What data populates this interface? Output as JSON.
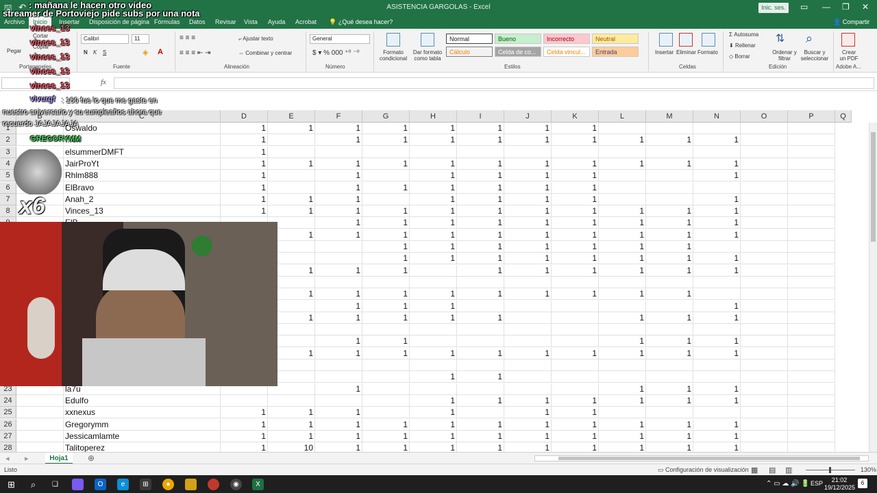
{
  "window": {
    "title": "ASISTENCIA GARGOLAS  -  Excel",
    "signin": "Inic. ses."
  },
  "tabs": [
    "Archivo",
    "Inicio",
    "Insertar",
    "Disposición de página",
    "Fórmulas",
    "Datos",
    "Revisar",
    "Vista",
    "Ayuda",
    "Acrobat"
  ],
  "tell_me": "¿Qué desea hacer?",
  "share": "Compartir",
  "ribbon": {
    "clipboard": {
      "cut": "Cortar",
      "copy": "Copiar",
      "paste": "Pegar",
      "label": "Portapapeles"
    },
    "font": {
      "name": "Calibri",
      "size": "11",
      "label": "Fuente",
      "bold": "N",
      "italic": "K",
      "underline": "S"
    },
    "alignment": {
      "wrap": "Ajustar texto",
      "merge": "Combinar y centrar",
      "label": "Alineación"
    },
    "number": {
      "format": "General",
      "label": "Número"
    },
    "styles": {
      "cond": "Formato condicional",
      "table": "Dar formato como tabla",
      "label": "Estilos",
      "normal": "Normal",
      "bueno": "Bueno",
      "incorrecto": "Incorrecto",
      "neutral": "Neutral",
      "calculo": "Cálculo",
      "celda_co": "Celda de co...",
      "celda_vinc": "Celda vincul...",
      "entrada": "Entrada"
    },
    "cells": {
      "insert": "Insertar",
      "delete": "Eliminar",
      "format": "Formato",
      "label": "Celdas"
    },
    "editing": {
      "autosum": "Autosuma",
      "fill": "Rellenar",
      "clear": "Borrar",
      "sort": "Ordenar y filtrar",
      "find": "Buscar y seleccionar",
      "label": "Edición"
    },
    "adobe": {
      "create": "Crear un PDF",
      "label": "Adobe A..."
    }
  },
  "formula": {
    "fx": "fx"
  },
  "columns": [
    "B",
    "C",
    "D",
    "E",
    "F",
    "G",
    "H",
    "I",
    "J",
    "K",
    "L",
    "M",
    "N",
    "O",
    "P",
    "Q"
  ],
  "rows": [
    {
      "n": "1",
      "name": "Oswaldo",
      "v": [
        "1",
        "1",
        "1",
        "1",
        "1",
        "1",
        "1",
        "1",
        "",
        "",
        ""
      ]
    },
    {
      "n": "2",
      "name": "...ex",
      "v": [
        "1",
        "",
        "1",
        "1",
        "1",
        "1",
        "1",
        "1",
        "1",
        "1",
        "1"
      ]
    },
    {
      "n": "3",
      "name": "elsummerDMFT",
      "v": [
        "1",
        "",
        "",
        "",
        "",
        "",
        "",
        "",
        "",
        "",
        ""
      ]
    },
    {
      "n": "4",
      "name": "JairProYt",
      "v": [
        "1",
        "1",
        "1",
        "1",
        "1",
        "1",
        "1",
        "1",
        "1",
        "1",
        "1"
      ]
    },
    {
      "n": "5",
      "name": "Rhlm888",
      "v": [
        "1",
        "",
        "1",
        "",
        "1",
        "1",
        "1",
        "1",
        "",
        "",
        "1"
      ]
    },
    {
      "n": "6",
      "name": "ElBravo",
      "v": [
        "1",
        "",
        "1",
        "1",
        "1",
        "1",
        "1",
        "1",
        "",
        "",
        ""
      ]
    },
    {
      "n": "7",
      "name": "Anah_2",
      "v": [
        "1",
        "1",
        "1",
        "",
        "1",
        "1",
        "1",
        "1",
        "",
        "",
        "1"
      ]
    },
    {
      "n": "8",
      "name": "Vinces_13",
      "v": [
        "1",
        "1",
        "1",
        "1",
        "1",
        "1",
        "1",
        "1",
        "1",
        "1",
        "1"
      ]
    },
    {
      "n": "9",
      "name": "ElB...",
      "v": [
        "",
        "",
        "1",
        "1",
        "1",
        "1",
        "1",
        "1",
        "1",
        "1",
        "1"
      ]
    },
    {
      "n": "10",
      "name": "",
      "v": [
        "",
        "1",
        "1",
        "1",
        "1",
        "1",
        "1",
        "1",
        "1",
        "1",
        "1"
      ]
    },
    {
      "n": "11",
      "name": "",
      "v": [
        "",
        "",
        "",
        "1",
        "1",
        "1",
        "1",
        "1",
        "1",
        "1",
        ""
      ]
    },
    {
      "n": "12",
      "name": "",
      "v": [
        "",
        "",
        "",
        "1",
        "1",
        "1",
        "1",
        "1",
        "1",
        "1",
        "1"
      ]
    },
    {
      "n": "13",
      "name": "",
      "v": [
        "",
        "1",
        "1",
        "1",
        "",
        "1",
        "1",
        "1",
        "1",
        "1",
        "1"
      ]
    },
    {
      "n": "14",
      "name": "",
      "v": [
        "",
        "",
        "",
        "",
        "",
        "",
        "",
        "",
        "",
        "",
        ""
      ]
    },
    {
      "n": "15",
      "name": "",
      "v": [
        "",
        "1",
        "1",
        "1",
        "1",
        "1",
        "1",
        "1",
        "1",
        "1",
        ""
      ]
    },
    {
      "n": "16",
      "name": "",
      "v": [
        "",
        "",
        "1",
        "1",
        "1",
        "",
        "",
        "",
        "",
        "",
        "1"
      ]
    },
    {
      "n": "17",
      "name": "",
      "v": [
        "",
        "1",
        "1",
        "1",
        "1",
        "1",
        "",
        "",
        "1",
        "1",
        "1"
      ]
    },
    {
      "n": "18",
      "name": "",
      "v": [
        "",
        "",
        "",
        "",
        "",
        "",
        "",
        "",
        "",
        "",
        ""
      ]
    },
    {
      "n": "19",
      "name": "",
      "v": [
        "",
        "",
        "1",
        "1",
        "",
        "",
        "",
        "",
        "1",
        "1",
        "1"
      ]
    },
    {
      "n": "20",
      "name": "",
      "v": [
        "",
        "1",
        "1",
        "1",
        "1",
        "1",
        "1",
        "1",
        "1",
        "1",
        "1"
      ]
    },
    {
      "n": "21",
      "name": "",
      "v": [
        "",
        "",
        "",
        "",
        "",
        "",
        "",
        "",
        "",
        "",
        ""
      ]
    },
    {
      "n": "22",
      "name": "",
      "v": [
        "",
        "",
        "",
        "",
        "1",
        "1",
        "",
        "",
        "",
        "",
        ""
      ]
    },
    {
      "n": "23",
      "name": "la7u",
      "v": [
        "",
        "",
        "1",
        "",
        "",
        "",
        "",
        "",
        "1",
        "1",
        "1"
      ]
    },
    {
      "n": "24",
      "name": "Edulfo",
      "v": [
        "",
        "",
        "",
        "",
        "1",
        "1",
        "1",
        "1",
        "1",
        "1",
        "1"
      ]
    },
    {
      "n": "25",
      "name": "xxnexus",
      "v": [
        "1",
        "1",
        "1",
        "",
        "1",
        "",
        "1",
        "1",
        "",
        "",
        ""
      ]
    },
    {
      "n": "26",
      "name": "Gregorymm",
      "v": [
        "1",
        "1",
        "1",
        "1",
        "1",
        "1",
        "1",
        "1",
        "1",
        "1",
        "1"
      ]
    },
    {
      "n": "27",
      "name": "Jessicamlamte",
      "v": [
        "1",
        "1",
        "1",
        "1",
        "1",
        "1",
        "1",
        "1",
        "1",
        "1",
        "1"
      ]
    },
    {
      "n": "28",
      "name": "Talitoperez",
      "v": [
        "1",
        "10",
        "1",
        "1",
        "1",
        "1",
        "1",
        "1",
        "1",
        "1",
        "1"
      ]
    }
  ],
  "sheet": {
    "name": "Hoja1"
  },
  "status": {
    "ready": "Listo",
    "display_settings": "Configuración de visualización",
    "zoom": "130%"
  },
  "taskbar": {
    "lang": "ESP",
    "time": "21:02",
    "date": "19/12/2025",
    "notif": "6"
  },
  "overlay": {
    "top_msg_1": ": mañana le hacen otro video",
    "top_msg_2": "streamer de Portoviejo pide subs por una nota",
    "vinces": [
      "vinces_13",
      "vinces_13",
      "vinces_13",
      "vinces_13",
      "vinces_13"
    ],
    "chat_user": "vivurgf",
    "chat_text": ": 160 fue lo que me gaste en nuestro aniversario y su cumpleaños ahora que recuerdo JAJAJAJAJA",
    "gregory": "GREGORYMM",
    "multiplier": "x6"
  }
}
